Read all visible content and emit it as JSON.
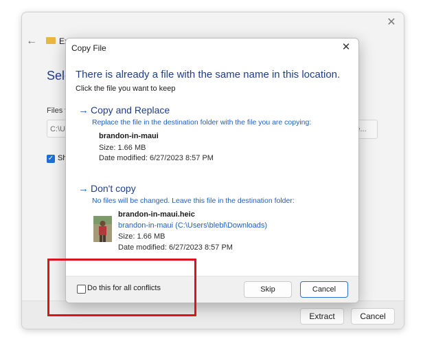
{
  "background_window": {
    "title": "Ex",
    "heading": "Sele",
    "files_label": "Files v",
    "path_text": "C:\\U",
    "browse_text": "e...",
    "show_label": "Sh",
    "extract_label": "Extract",
    "cancel_label": "Cancel"
  },
  "dialog": {
    "title": "Copy File",
    "headline": "There is already a file with the same name in this location.",
    "subline": "Click the file you want to keep",
    "replace": {
      "title": "Copy and Replace",
      "description": "Replace the file in the destination folder with the file you are copying:",
      "file_name": "brandon-in-maui",
      "size": "Size: 1.66 MB",
      "date": "Date modified: 6/27/2023 8:57 PM"
    },
    "dont_copy": {
      "title": "Don't copy",
      "description": "No files will be changed. Leave this file in the destination folder:",
      "file_name": "brandon-in-maui.heic",
      "path": "brandon-in-maui (C:\\Users\\blebl\\Downloads)",
      "size": "Size: 1.66 MB",
      "date": "Date modified: 6/27/2023 8:57 PM"
    },
    "checkbox_label": "Do this for all conflicts",
    "skip_label": "Skip",
    "cancel_label": "Cancel"
  },
  "icons": {
    "close": "close-icon",
    "back": "arrow-left-icon",
    "option_arrow": "arrow-right-icon",
    "folder": "folder-zip-icon"
  },
  "colors": {
    "accent": "#1f5fbf",
    "heading": "#1f3d8a",
    "highlight": "#d9141a"
  }
}
